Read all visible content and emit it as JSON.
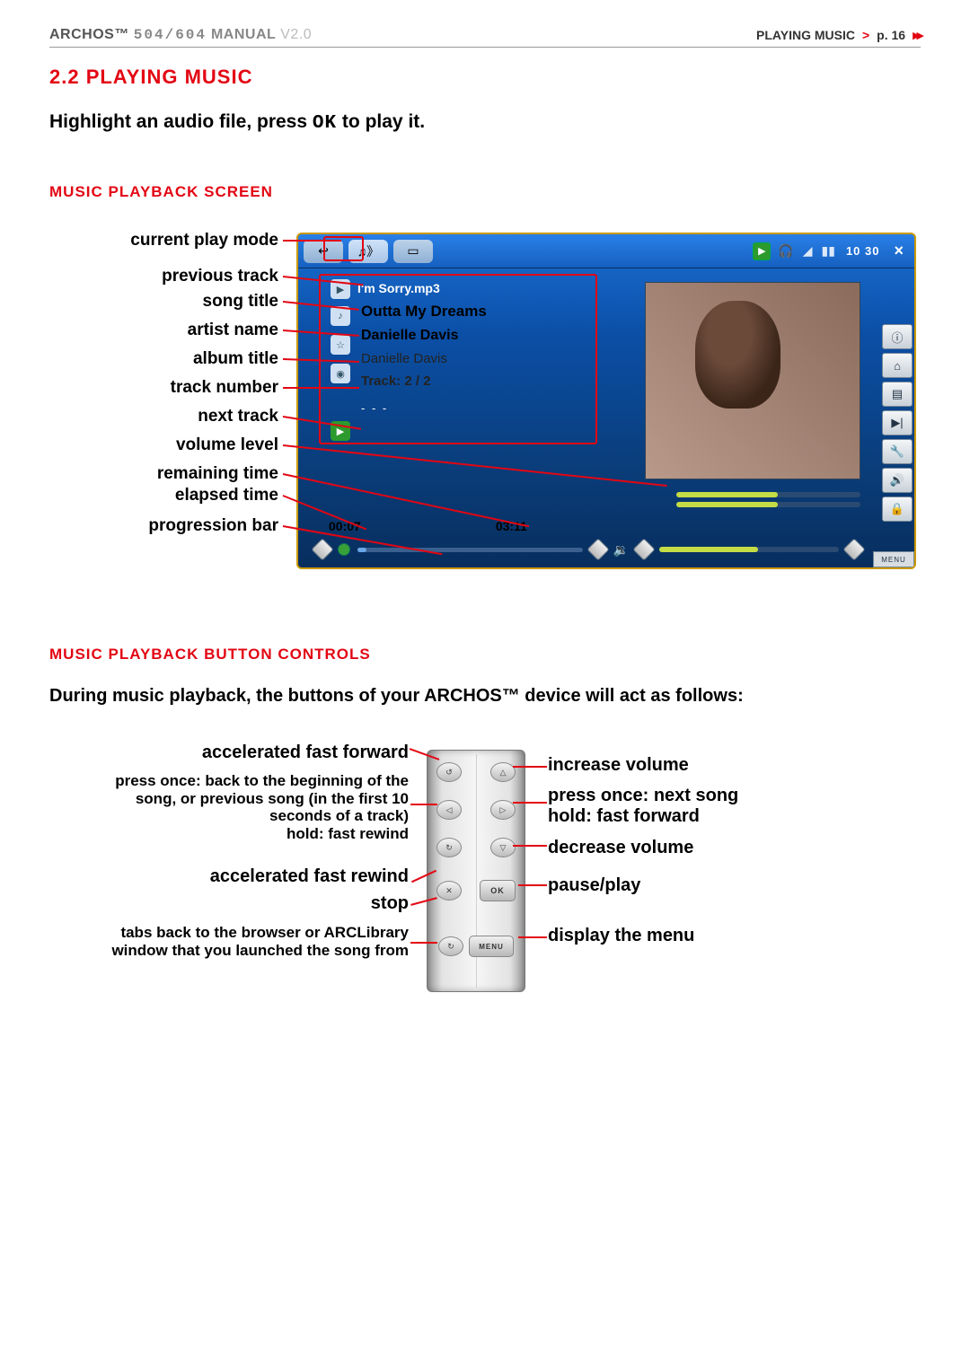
{
  "header": {
    "brand": "ARCHOS™",
    "model": "504/604",
    "manual": "MANUAL",
    "version": "V2.0",
    "crumb_section": "PLAYING MUSIC",
    "crumb_sep": ">",
    "crumb_page": "p. 16"
  },
  "section": {
    "num_title": "2.2  PLAYING MUSIC",
    "intro_pre": "Highlight an audio file, press ",
    "intro_ok": "OK",
    "intro_post": " to play it.",
    "sub1": "MUSIC PLAYBACK SCREEN",
    "sub2": "MUSIC PLAYBACK BUTTON CONTROLS",
    "controls_intro": "During music playback, the buttons of your ARCHOS™ device will act as follows:"
  },
  "callouts": {
    "current_play_mode": "current play mode",
    "previous_track": "previous track",
    "song_title": "song title",
    "artist_name": "artist name",
    "album_title": "album title",
    "track_number": "track number",
    "next_track": "next track",
    "volume_level": "volume level",
    "remaining_time": "remaining time",
    "elapsed_time": "elapsed time",
    "progression_bar": "progression bar"
  },
  "player": {
    "previous_track": "I'm Sorry.mp3",
    "song_title": "Outta My Dreams",
    "artist": "Danielle Davis",
    "album": "Danielle Davis",
    "track": "Track: 2 / 2",
    "next_track": "- - -",
    "elapsed": "00:07",
    "remaining": "03:11",
    "clock": "10 30",
    "menu_label": "MENU"
  },
  "controls": {
    "accel_ff": "accelerated fast forward",
    "back_prev": "press once: back to the beginning of the song, or previous  song (in the first 10 seconds of a track)\nhold: fast rewind",
    "accel_fr": "accelerated fast rewind",
    "stop": "stop",
    "tabs_back": "tabs back to the browser or ARCLibrary window that you launched the song from",
    "inc_vol": "increase volume",
    "next_ff": "press once: next song\nhold: fast forward",
    "dec_vol": "decrease volume",
    "pause_play": "pause/play",
    "display_menu": "display the menu",
    "ok_label": "OK",
    "menu_label": "MENU"
  }
}
